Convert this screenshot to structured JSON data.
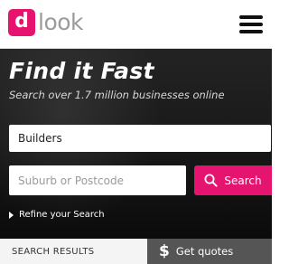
{
  "header": {
    "logo_mark": "d",
    "logo_text": "look",
    "menu_icon": "hamburger-icon"
  },
  "hero": {
    "title": "Find it Fast",
    "subtitle": "Search over 1.7 million businesses online",
    "keyword_value": "Builders",
    "location_placeholder": "Suburb or Postcode",
    "search_label": "Search",
    "search_icon": "search-icon",
    "refine_label": "Refine your Search"
  },
  "tabs": {
    "results_label": "SEARCH RESULTS",
    "quotes_icon": "$",
    "quotes_label": "Get quotes"
  },
  "colors": {
    "brand_pink": "#e5146e",
    "hero_background": "#1a1a1a",
    "tab_dark": "#555555",
    "logo_grey": "#9b9b9b"
  }
}
